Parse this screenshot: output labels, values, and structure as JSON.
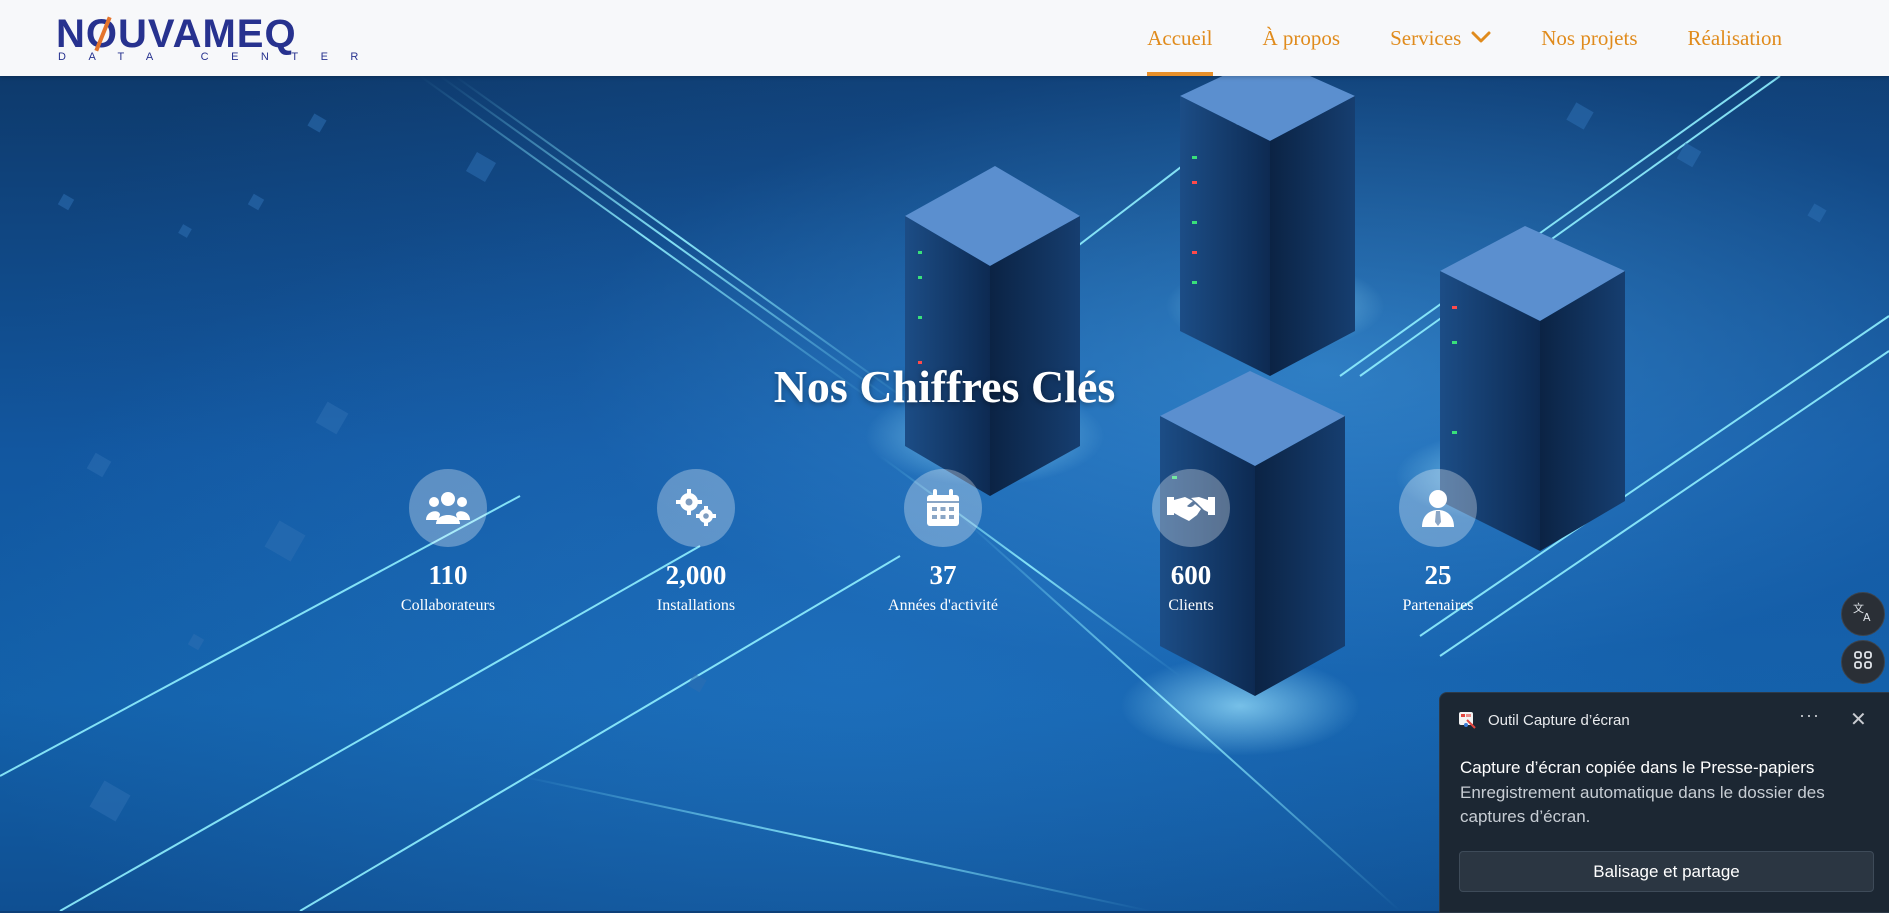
{
  "logo": {
    "brand": "NOUVAMEQ",
    "tagline": "DATA CENTER"
  },
  "nav": {
    "items": [
      {
        "label": "Accueil",
        "active": true
      },
      {
        "label": "À propos"
      },
      {
        "label": "Services",
        "has_dropdown": true
      },
      {
        "label": "Nos projets"
      },
      {
        "label": "Réalisation"
      }
    ]
  },
  "hero": {
    "title": "Nos Chiffres Clés",
    "stats": [
      {
        "icon": "users-icon",
        "value": "110",
        "label": "Collaborateurs"
      },
      {
        "icon": "gears-icon",
        "value": "2,000",
        "label": "Installations"
      },
      {
        "icon": "calendar-icon",
        "value": "37",
        "label": "Années d'activité"
      },
      {
        "icon": "handshake-icon",
        "value": "600",
        "label": "Clients"
      },
      {
        "icon": "person-tie-icon",
        "value": "25",
        "label": "Partenaires"
      }
    ]
  },
  "side_buttons": [
    {
      "icon": "translate-icon"
    },
    {
      "icon": "apps-grid-icon"
    }
  ],
  "toast": {
    "app_name": "Outil Capture d’écran",
    "title": "Capture d’écran copiée dans le Presse-papiers",
    "body": "Enregistrement automatique dans le dossier des captures d’écran.",
    "button_label": "Balisage et partage",
    "more_label": "···",
    "close_label": "✕"
  },
  "colors": {
    "accent": "#e08b1c",
    "brand": "#27328f",
    "hero": "#1257a0",
    "toast_bg": "#1c2733"
  }
}
